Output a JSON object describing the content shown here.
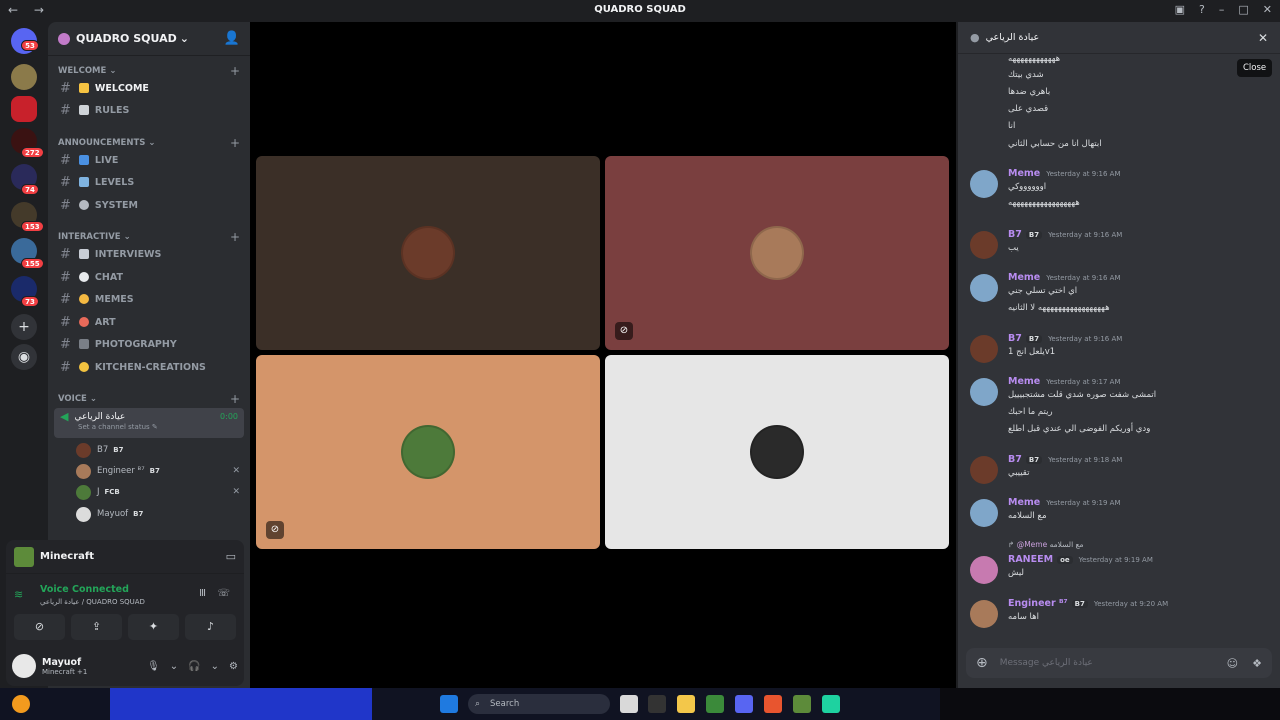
{
  "window": {
    "title": "QUADRO SQUAD",
    "back": "←",
    "forward": "→"
  },
  "server": {
    "name": "QUADRO SQUAD",
    "chevron": "⌄",
    "icon": "add-person-icon"
  },
  "rail": {
    "badges": [
      "53",
      "272",
      "74",
      "153",
      "155",
      "73"
    ]
  },
  "categories": [
    {
      "name": "WELCOME",
      "chev": "⌄",
      "plus": "+"
    },
    {
      "name": "ANNOUNCEMENTS",
      "chev": "⌄",
      "plus": "+"
    },
    {
      "name": "INTERACTIVE",
      "chev": "⌄",
      "plus": "+"
    },
    {
      "name": "VOICE",
      "chev": "⌄",
      "plus": "+"
    }
  ],
  "channels": [
    {
      "label": "WELCOME",
      "emoji_color": "#f6c342"
    },
    {
      "label": "RULES",
      "emoji_color": "#cfd3d8"
    },
    {
      "label": "LIVE",
      "emoji_color": "#4a90e2"
    },
    {
      "label": "LEVELS",
      "emoji_color": "#7fb3e0"
    },
    {
      "label": "SYSTEM",
      "emoji_color": "#b5bac1"
    },
    {
      "label": "INTERVIEWS",
      "emoji_color": "#c9ced6"
    },
    {
      "label": "CHAT",
      "emoji_color": "#e8eaed"
    },
    {
      "label": "MEMES",
      "emoji_color": "#f4b942"
    },
    {
      "label": "ART",
      "emoji_color": "#e86a5a"
    },
    {
      "label": "PHOTOGRAPHY",
      "emoji_color": "#7a7f87"
    },
    {
      "label": "KITCHEN-CREATIONS",
      "emoji_color": "#f3c340"
    }
  ],
  "voice_channel": {
    "name": "عيادة الرياعي",
    "time": "0:00",
    "status": "Set a channel status"
  },
  "voice_users": [
    {
      "name": "B7",
      "tag": "B7",
      "muted": ""
    },
    {
      "name": "Engineer ᴮ⁷",
      "tag": "B7",
      "muted": "✕"
    },
    {
      "name": "J",
      "tag": "FCB",
      "muted": "✕"
    },
    {
      "name": "Mayuof",
      "tag": "B7",
      "muted": ""
    }
  ],
  "activity": {
    "game": "Minecraft"
  },
  "voice_status": {
    "title": "Voice Connected",
    "subtitle": "عيادة الرياعي / QUADRO SQUAD"
  },
  "current_user": {
    "name": "Mayuof",
    "status": "Minecraft +1"
  },
  "tiles": [
    {
      "bg": "#3b2f27",
      "avatar": "#6b3b2a",
      "muted": false
    },
    {
      "bg": "#7a3f3f",
      "avatar": "#a87a5a",
      "muted": true
    },
    {
      "bg": "#d4956a",
      "avatar": "#4d7a3a",
      "muted": true
    },
    {
      "bg": "#e6e6e6",
      "avatar": "#2a2a2a",
      "muted": false
    }
  ],
  "chat": {
    "title": "عيادة الرياعي",
    "tooltip": "Close",
    "top_lines": [
      "ههههههههههههه",
      "شدي بيتك",
      "باهري ضدها",
      "قصدي على",
      "انا",
      "ابتهال انا من حسابي الثاني"
    ],
    "messages": [
      {
        "name": "Meme",
        "color": "#b88cf0",
        "tag": "",
        "time": "Yesterday at 9:16 AM",
        "lines": [
          "اووووووكي",
          "هههههههههههههههههه"
        ]
      },
      {
        "name": "B7",
        "color": "#b88cf0",
        "tag": "B7",
        "time": "Yesterday at 9:16 AM",
        "lines": [
          "يب"
        ]
      },
      {
        "name": "Meme",
        "color": "#b88cf0",
        "tag": "",
        "time": "Yesterday at 9:16 AM",
        "lines": [
          "اي اختي تسلي جني",
          "هههههههههههههههههه لا الثانيه"
        ]
      },
      {
        "name": "B7",
        "color": "#b88cf0",
        "tag": "B7",
        "time": "Yesterday at 9:16 AM",
        "lines": [
          "يلعل انج 1v1"
        ]
      },
      {
        "name": "Meme",
        "color": "#b88cf0",
        "tag": "",
        "time": "Yesterday at 9:17 AM",
        "lines": [
          "اتمشى شفت صوره شدي قلت مشتجبيييل",
          "ريتم ما احبك",
          "ودي أوريكم الفوضى الي عندي قبل اطلع"
        ]
      },
      {
        "name": "B7",
        "color": "#b88cf0",
        "tag": "B7",
        "time": "Yesterday at 9:18 AM",
        "lines": [
          "تقييبي"
        ]
      },
      {
        "name": "Meme",
        "color": "#b88cf0",
        "tag": "",
        "time": "Yesterday at 9:19 AM",
        "lines": [
          "مع السلامه"
        ]
      },
      {
        "name": "RANEEM",
        "color": "#b88cf0",
        "tag": "oe",
        "time": "Yesterday at 9:19 AM",
        "lines": [
          "ليش"
        ],
        "reply_to": "@Meme",
        "reply_text": "مع السلامه"
      },
      {
        "name": "Engineer ᴮ⁷",
        "color": "#b88cf0",
        "tag": "B7",
        "time": "Yesterday at 9:20 AM",
        "lines": [
          "اها سامه"
        ]
      }
    ],
    "input_placeholder": "Message عيادة الرياعي"
  },
  "taskbar": {
    "search_placeholder": "Search"
  }
}
